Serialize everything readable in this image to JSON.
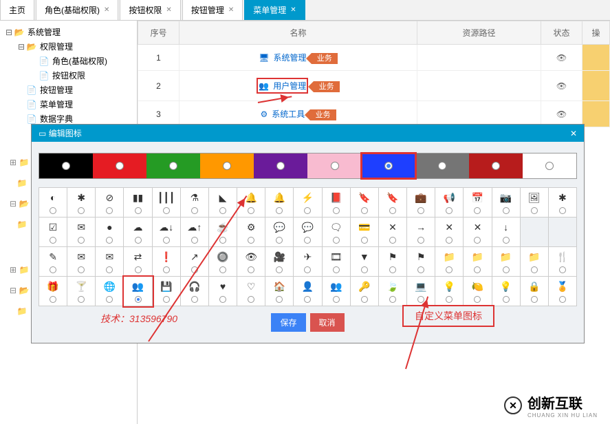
{
  "tabs": [
    {
      "label": "主页",
      "closable": false
    },
    {
      "label": "角色(基础权限)",
      "closable": true
    },
    {
      "label": "按钮权限",
      "closable": true
    },
    {
      "label": "按钮管理",
      "closable": true
    },
    {
      "label": "菜单管理",
      "closable": true,
      "active": true
    }
  ],
  "tree": {
    "root": {
      "label": "系统管理"
    },
    "perm": {
      "label": "权限管理"
    },
    "role": {
      "label": "角色(基础权限)"
    },
    "btnPerm": {
      "label": "按钮权限"
    },
    "btnMgmt": {
      "label": "按钮管理"
    },
    "menuMgmt": {
      "label": "菜单管理"
    },
    "dataDict": {
      "label": "数据字典"
    }
  },
  "table": {
    "headers": {
      "seq": "序号",
      "name": "名称",
      "path": "资源路径",
      "status": "状态",
      "op": "操"
    },
    "rows": [
      {
        "seq": "1",
        "name": "系统管理",
        "icon": "🖥",
        "tag": "业务"
      },
      {
        "seq": "2",
        "name": "用户管理",
        "icon": "👥",
        "tag": "业务",
        "highlight": true
      },
      {
        "seq": "3",
        "name": "系统工具",
        "icon": "⚙",
        "tag": "业务"
      }
    ]
  },
  "modal": {
    "title": "编辑图标",
    "colors": [
      {
        "hex": "#000000"
      },
      {
        "hex": "#e51c23"
      },
      {
        "hex": "#259b24"
      },
      {
        "hex": "#ff9800"
      },
      {
        "hex": "#6a1b9a"
      },
      {
        "hex": "#f8bbd0"
      },
      {
        "hex": "#1e3fff",
        "selected": true
      },
      {
        "hex": "#757575"
      },
      {
        "hex": "#b71c1c"
      },
      {
        "hex": "#ffffff"
      }
    ],
    "icons_row1": [
      "◐",
      "✱",
      "⊘",
      "▮▮",
      "┃┃┃",
      "⚗",
      "◣",
      "🔔",
      "🔔",
      "⚡",
      "📕",
      "🔖",
      "🔖",
      "💼",
      "📢",
      "📅",
      "📷",
      "🖼",
      "✱"
    ],
    "icons_row2": [
      "☑",
      "✉",
      "●",
      "☁",
      "☁↓",
      "☁↑",
      "☕",
      "⚙",
      "💬",
      "💬",
      "🗨",
      "💳",
      "✕",
      "→",
      "✕",
      "✕",
      "↓"
    ],
    "icons_row3": [
      "✎",
      "✉",
      "✉",
      "⇄",
      "❗",
      "↗",
      "🔘",
      "👁",
      "🎥",
      "✈",
      "🎞",
      "▼",
      "⚑",
      "⚑",
      "📁",
      "📁",
      "📁",
      "📁",
      "🍴"
    ],
    "icons_row4": [
      "🎁",
      "🍸",
      "🌐",
      "👥",
      "💾",
      "🎧",
      "♥",
      "♡",
      "🏠",
      "👤",
      "👥",
      "🔑",
      "🍃",
      "💻",
      "💡",
      "🍋",
      "💡",
      "🔒",
      "🏅"
    ],
    "selected_icon_index": 60,
    "save": "保存",
    "cancel": "取消",
    "callout": "自定义菜单图标",
    "credit": "技术：313596790"
  },
  "brand": {
    "name": "创新互联",
    "logo": "✕",
    "sub": "CHUANG XIN HU LIAN"
  }
}
